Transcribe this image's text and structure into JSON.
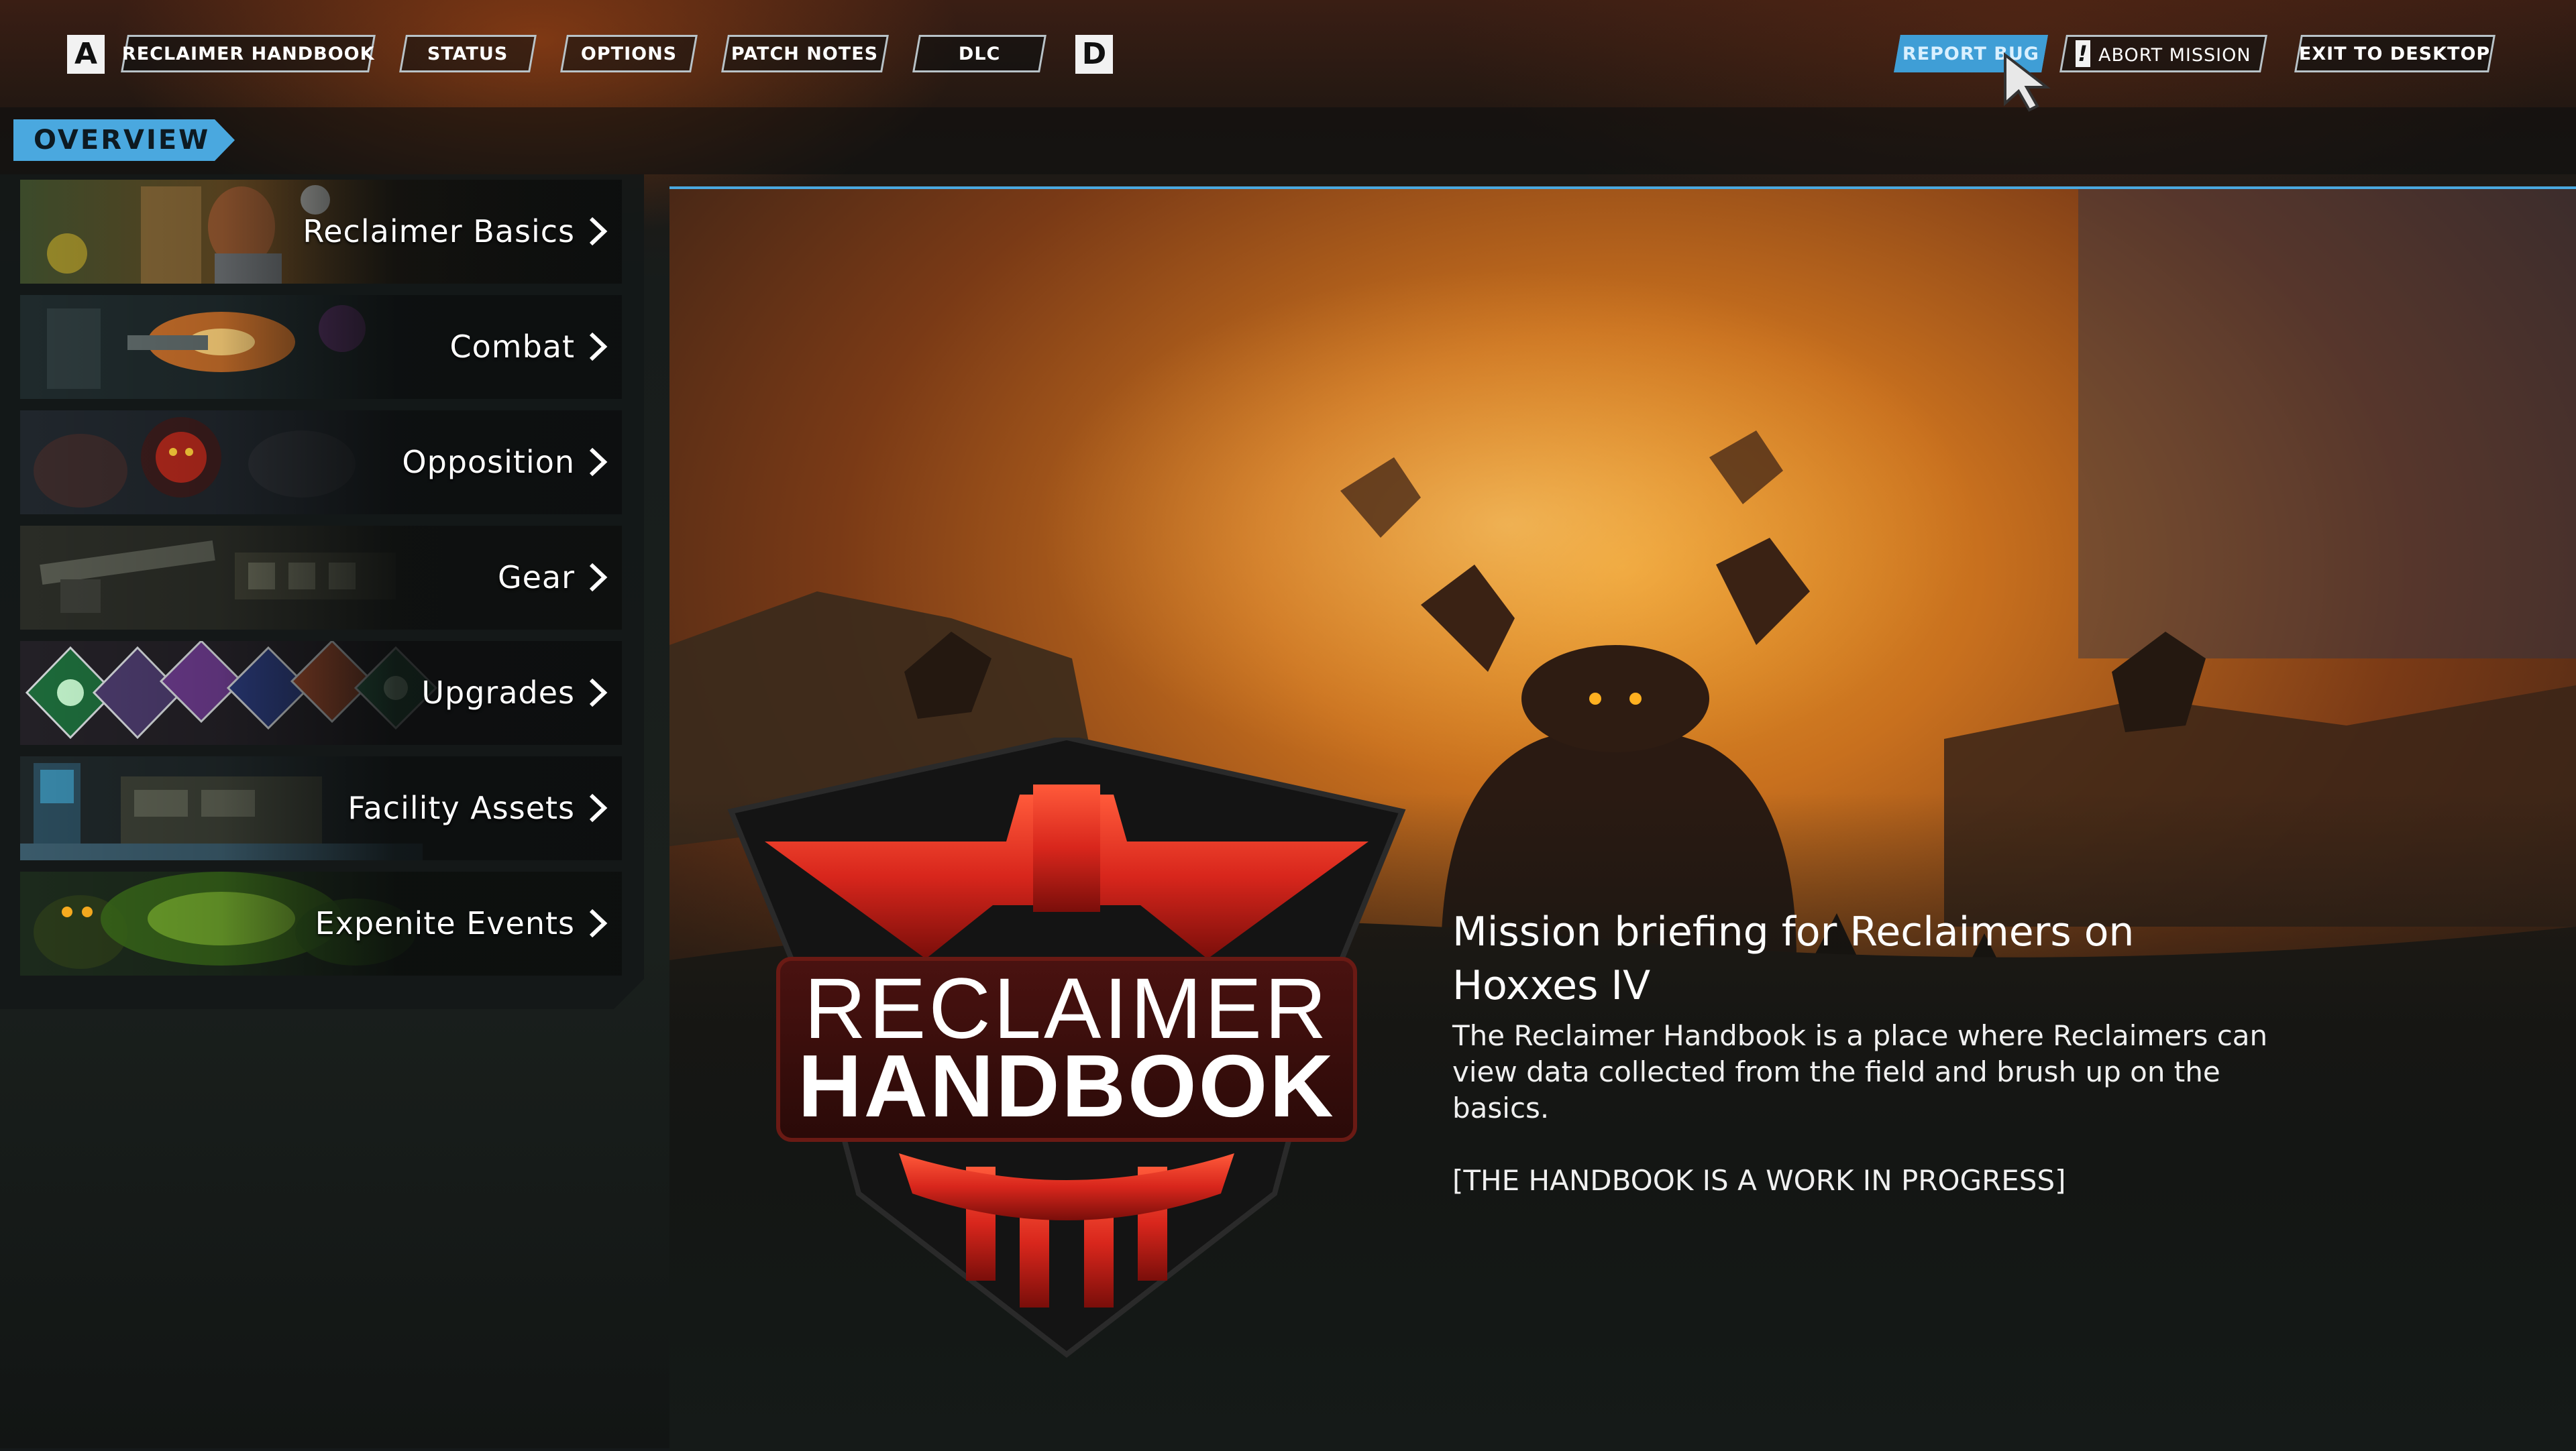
{
  "topnav": {
    "left_key": "A",
    "right_key": "D",
    "tabs": [
      {
        "label": "RECLAIMER HANDBOOK"
      },
      {
        "label": "STATUS"
      },
      {
        "label": "OPTIONS"
      },
      {
        "label": "PATCH NOTES"
      },
      {
        "label": "DLC"
      }
    ],
    "actions": {
      "report_bug": "REPORT BUG",
      "abort_mission": "ABORT MISSION",
      "exit_to_desktop": "EXIT TO DESKTOP"
    }
  },
  "section_tab": "OVERVIEW",
  "sidebar": {
    "items": [
      {
        "label": "Reclaimer Basics"
      },
      {
        "label": "Combat"
      },
      {
        "label": "Opposition"
      },
      {
        "label": "Gear"
      },
      {
        "label": "Upgrades"
      },
      {
        "label": "Facility Assets"
      },
      {
        "label": "Expenite Events"
      }
    ]
  },
  "emblem": {
    "line1": "RECLAIMER",
    "line2": "HANDBOOK"
  },
  "briefing": {
    "title": "Mission briefing for Reclaimers on Hoxxes IV",
    "body": "The Reclaimer Handbook is a place where Reclaimers can view data collected from the field and brush up on the basics.",
    "note": "[THE HANDBOOK IS A WORK IN PROGRESS]"
  },
  "colors": {
    "accent_blue": "#4aa8df",
    "emblem_red": "#d8261c",
    "hero_orange": "#c8701e"
  }
}
